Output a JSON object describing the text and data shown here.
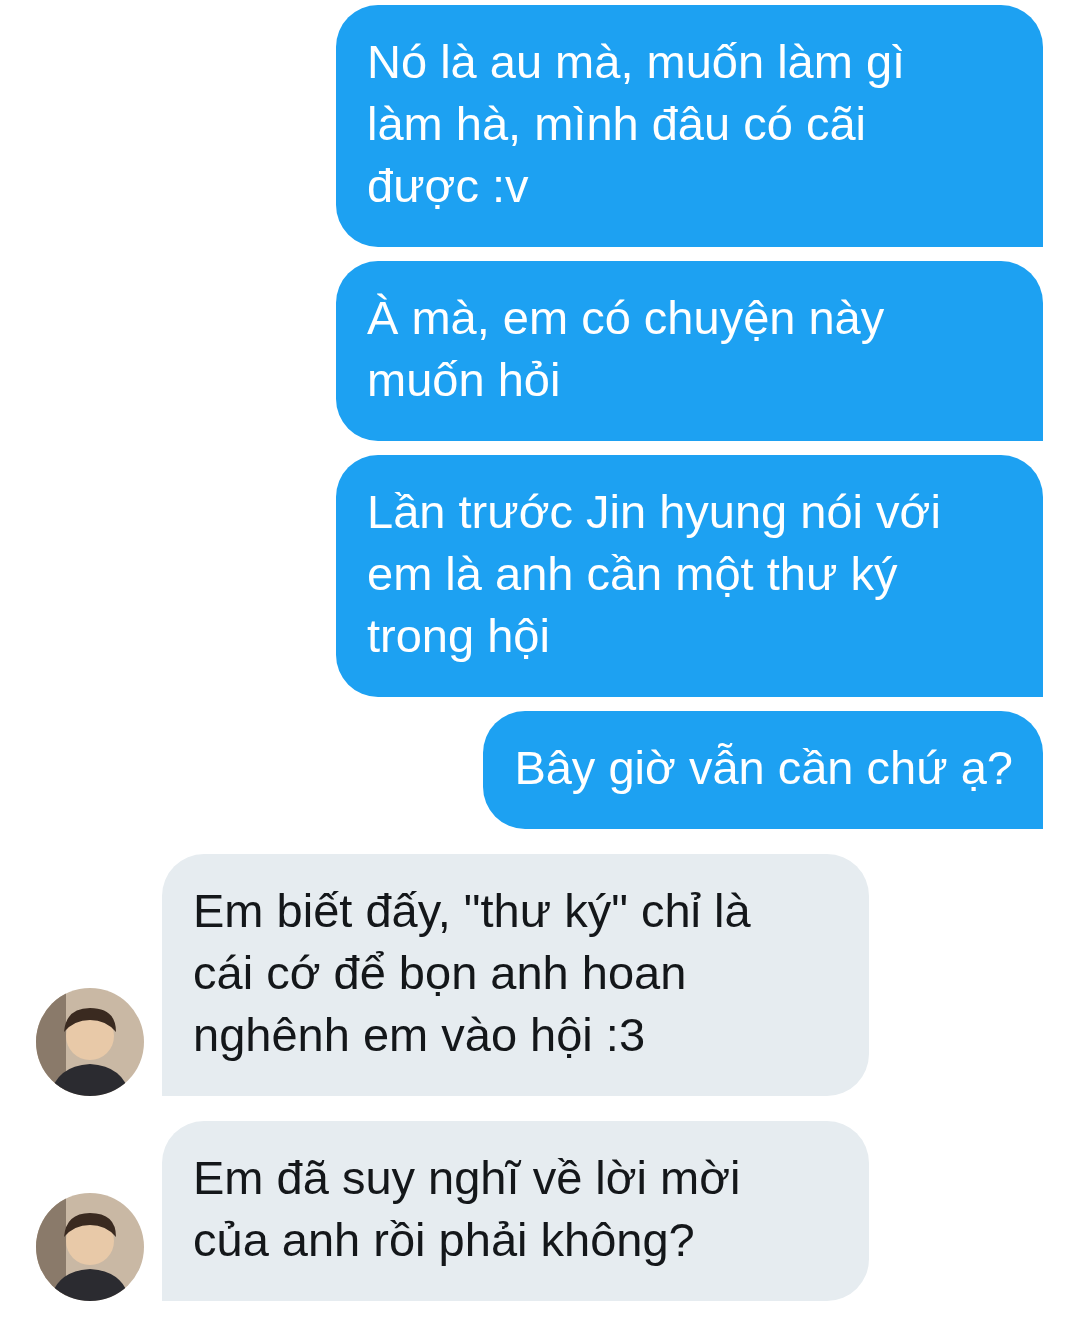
{
  "messages": [
    {
      "kind": "sent",
      "lines": [
        "Nó là au mà, muốn làm gì",
        "làm hà, mình đâu có cãi",
        "được :v"
      ]
    },
    {
      "kind": "sent",
      "lines": [
        "À mà, em có chuyện này",
        "muốn hỏi"
      ]
    },
    {
      "kind": "sent",
      "lines": [
        "Lần trước Jin hyung nói với",
        "em là anh cần một thư ký",
        "trong hội"
      ]
    },
    {
      "kind": "sent",
      "lines": [
        "Bây giờ vẫn cần chứ ạ?"
      ]
    },
    {
      "kind": "received",
      "lines": [
        "Em biết đấy, \"thư ký\" chỉ là",
        "cái cớ để bọn anh hoan",
        "nghênh em vào hội :3"
      ]
    },
    {
      "kind": "received",
      "lines": [
        "Em đã suy nghĩ về lời mời",
        "của anh rồi phải không?"
      ]
    }
  ]
}
